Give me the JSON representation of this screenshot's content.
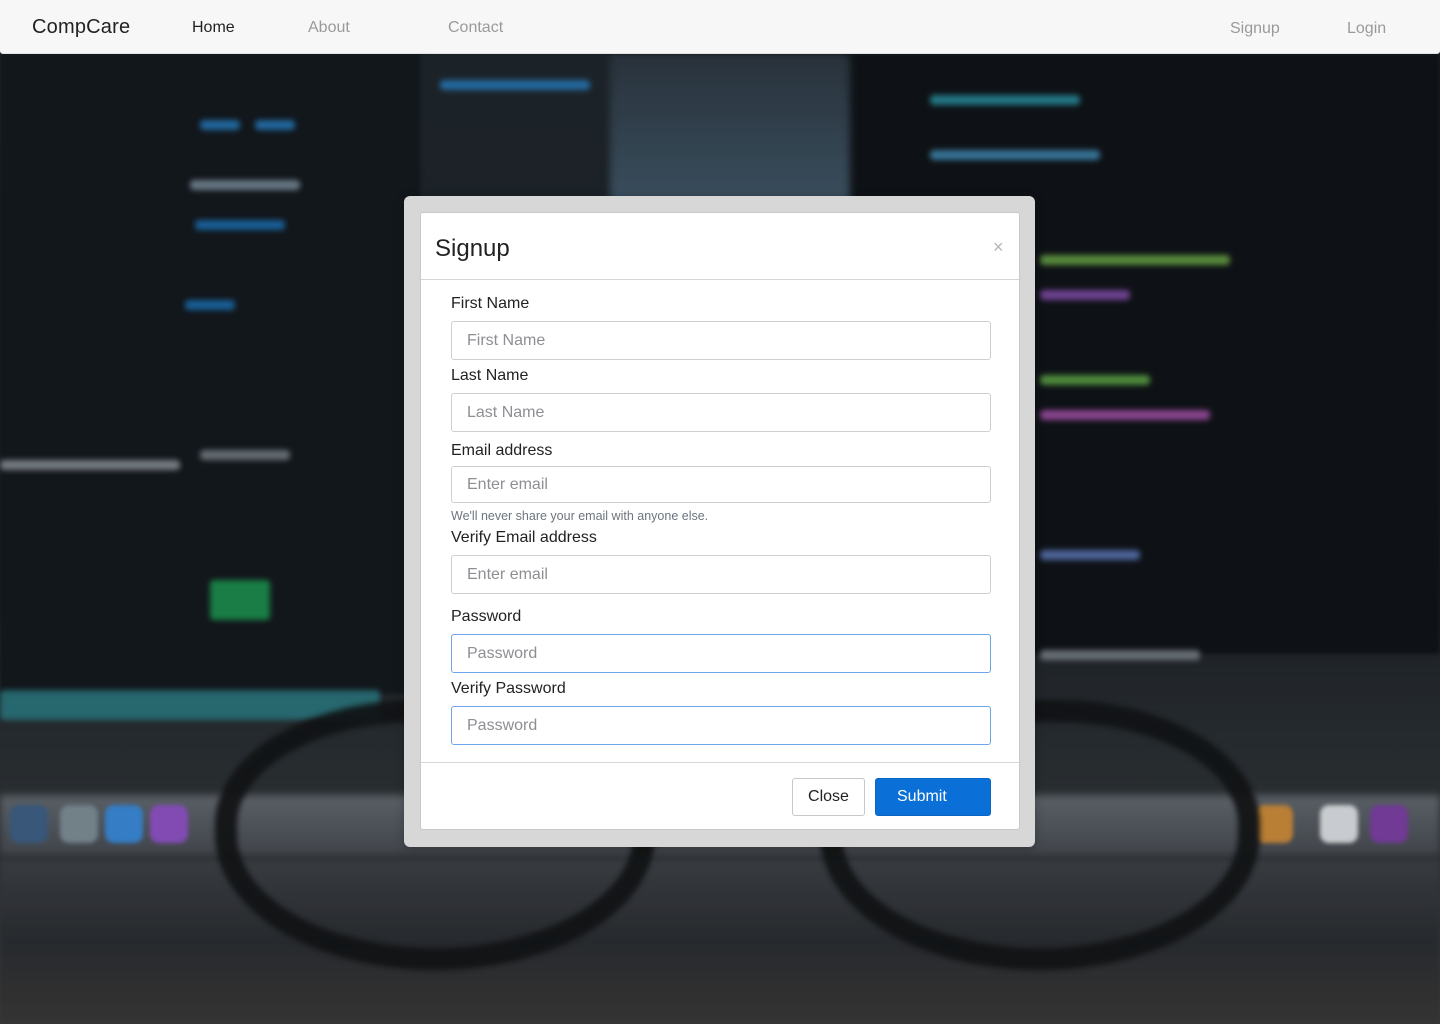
{
  "navbar": {
    "brand": "CompCare",
    "links": [
      {
        "label": "Home",
        "active": true
      },
      {
        "label": "About",
        "active": false
      },
      {
        "label": "Contact",
        "active": false
      }
    ],
    "right_links": [
      {
        "label": "Signup"
      },
      {
        "label": "Login"
      }
    ]
  },
  "modal": {
    "title": "Signup",
    "close_symbol": "×",
    "fields": [
      {
        "label": "First Name",
        "placeholder": "First Name",
        "value": ""
      },
      {
        "label": "Last Name",
        "placeholder": "Last Name",
        "value": ""
      },
      {
        "label": "Email address",
        "placeholder": "Enter email",
        "value": "",
        "help": "We'll never share your email with anyone else."
      },
      {
        "label": "Verify Email address",
        "placeholder": "Enter email",
        "value": ""
      },
      {
        "label": "Password",
        "placeholder": "Password",
        "value": ""
      },
      {
        "label": "Verify Password",
        "placeholder": "Password",
        "value": ""
      }
    ],
    "buttons": {
      "close": "Close",
      "submit": "Submit"
    }
  },
  "colors": {
    "primary": "#0a6fd6",
    "focus_border": "#6da6e8",
    "navbar_bg": "#f7f7f8"
  },
  "icons": {
    "modal_close": "close-icon"
  }
}
